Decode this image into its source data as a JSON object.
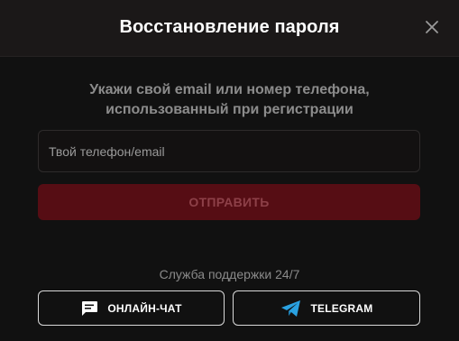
{
  "modal": {
    "title": "Восстановление пароля",
    "close_icon": "close-icon"
  },
  "form": {
    "instruction_line1": "Укажи свой email или номер телефона,",
    "instruction_line2": "использованный при регистрации",
    "contact_placeholder": "Твой телефон/email",
    "contact_value": "",
    "submit_label": "ОТПРАВИТЬ",
    "submit_disabled": true
  },
  "support": {
    "label": "Служба поддержки 24/7",
    "chat_label": "ОНЛАЙН-ЧАТ",
    "chat_icon": "chat-icon",
    "telegram_label": "TELEGRAM",
    "telegram_icon": "telegram-icon"
  },
  "colors": {
    "background": "#111111",
    "header": "#1b1818",
    "submit_disabled_bg": "#560d14",
    "submit_disabled_text": "#8d4048",
    "telegram_blue": "#2aa1e0"
  }
}
